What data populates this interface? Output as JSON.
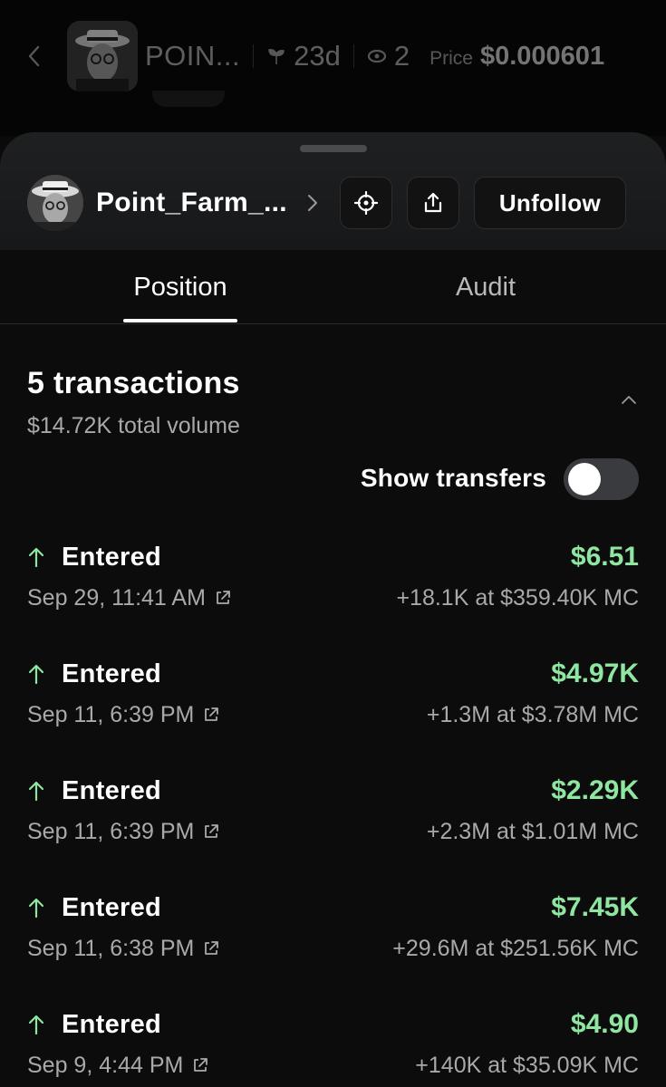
{
  "header": {
    "token_name": "POIN...",
    "age": "23d",
    "holders": "2",
    "price_label": "Price",
    "price_value": "$0.000601"
  },
  "profile": {
    "name": "Point_Farm_...",
    "unfollow_label": "Unfollow"
  },
  "tabs": [
    {
      "label": "Position",
      "active": true
    },
    {
      "label": "Audit",
      "active": false
    }
  ],
  "summary": {
    "title": "5 transactions",
    "subtitle": "$14.72K total volume",
    "show_transfers_label": "Show transfers",
    "show_transfers_on": false
  },
  "transactions": [
    {
      "type": "Entered",
      "time": "Sep 29, 11:41 AM",
      "amount": "$6.51",
      "detail": "+18.1K at $359.40K MC"
    },
    {
      "type": "Entered",
      "time": "Sep 11, 6:39 PM",
      "amount": "$4.97K",
      "detail": "+1.3M at $3.78M MC"
    },
    {
      "type": "Entered",
      "time": "Sep 11, 6:39 PM",
      "amount": "$2.29K",
      "detail": "+2.3M at $1.01M MC"
    },
    {
      "type": "Entered",
      "time": "Sep 11, 6:38 PM",
      "amount": "$7.45K",
      "detail": "+29.6M at $251.56K MC"
    },
    {
      "type": "Entered",
      "time": "Sep 9, 4:44 PM",
      "amount": "$4.90",
      "detail": "+140K at $35.09K MC"
    }
  ],
  "colors": {
    "background": "#0c0c0d",
    "positive": "#8ee6a0",
    "muted_text": "#a9a9a9",
    "button_border": "#2c2d2f"
  },
  "icons": [
    "chevron-left-icon",
    "sprout-icon",
    "eye-icon",
    "chevron-right-icon",
    "crosshair-icon",
    "share-icon",
    "chevron-up-icon",
    "arrow-up-icon",
    "external-link-icon"
  ]
}
